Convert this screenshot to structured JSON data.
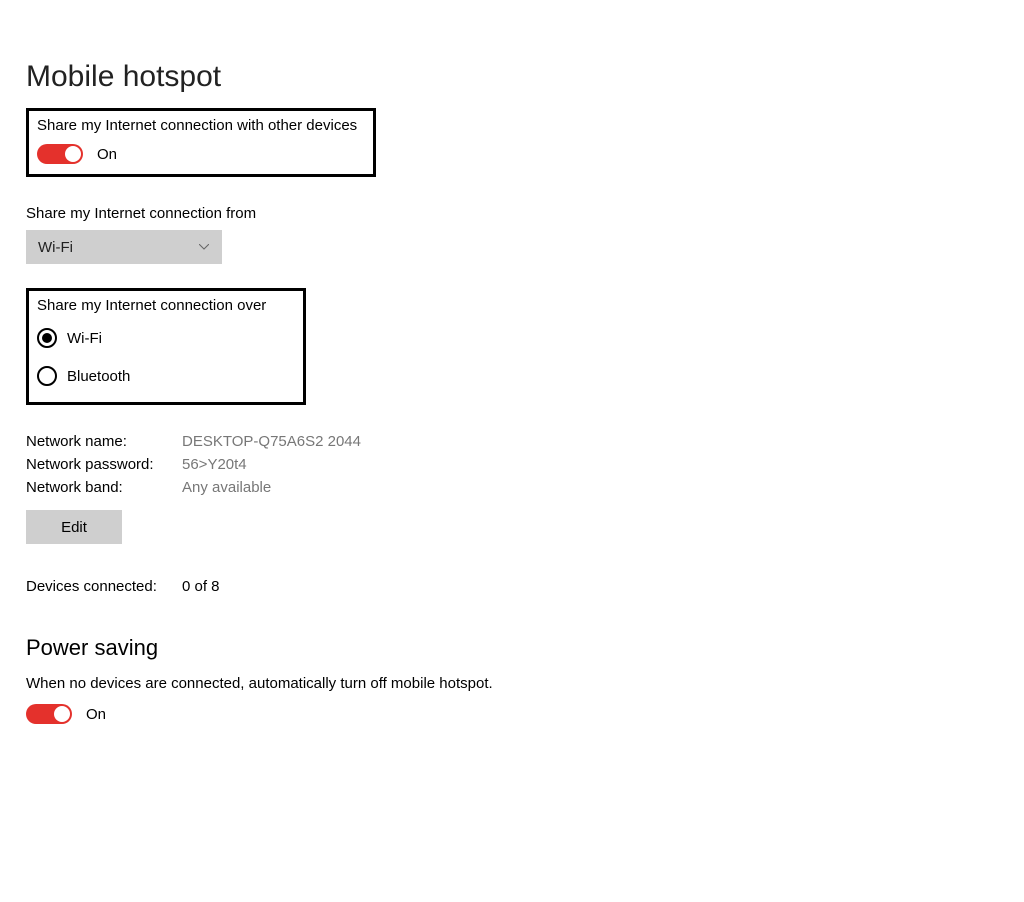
{
  "page": {
    "title": "Mobile hotspot"
  },
  "shareToggle": {
    "label": "Share my Internet connection with other devices",
    "state": "On"
  },
  "shareFrom": {
    "label": "Share my Internet connection from",
    "selected": "Wi-Fi"
  },
  "shareOver": {
    "label": "Share my Internet connection over",
    "options": {
      "wifi": "Wi-Fi",
      "bluetooth": "Bluetooth"
    }
  },
  "network": {
    "nameLabel": "Network name:",
    "nameValue": "DESKTOP-Q75A6S2 2044",
    "passwordLabel": "Network password:",
    "passwordValue": "56>Y20t4",
    "bandLabel": "Network band:",
    "bandValue": "Any available",
    "editButton": "Edit"
  },
  "devices": {
    "label": "Devices connected:",
    "value": "0 of 8"
  },
  "powerSaving": {
    "heading": "Power saving",
    "description": "When no devices are connected, automatically turn off mobile hotspot.",
    "state": "On"
  }
}
